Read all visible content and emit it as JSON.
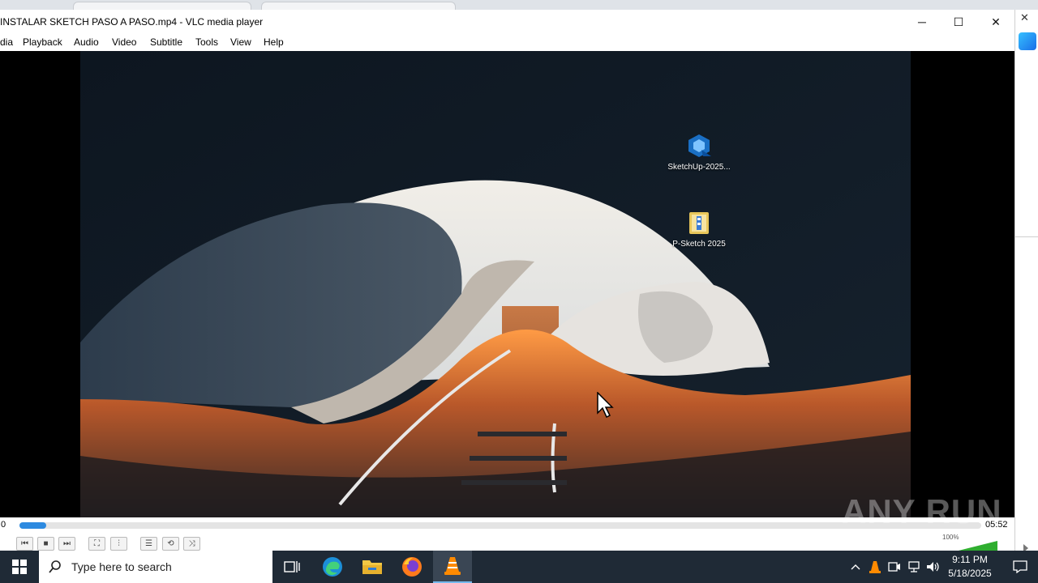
{
  "window": {
    "title": "INSTALAR SKETCH PASO A PASO.mp4 - VLC media player",
    "controls": {
      "minimize": "─",
      "maximize": "☐",
      "close": "✕"
    }
  },
  "menu": [
    "dia",
    "Playback",
    "Audio",
    "Video",
    "Subtitle",
    "Tools",
    "View",
    "Help"
  ],
  "desktop_icons": [
    {
      "label": "SketchUp-2025...",
      "icon": "sketchup-icon"
    },
    {
      "label": "P-Sketch 2025",
      "icon": "folder-archive-icon"
    }
  ],
  "playback": {
    "elapsed": "0",
    "total": "05:52",
    "progress": 0.028,
    "volume_label": "100%",
    "volume": 1.0
  },
  "controls": {
    "prev": "⏮",
    "stop": "■",
    "next": "⏭",
    "fullscreen": "⛶",
    "extended": "⫶",
    "playlist": "☰",
    "loop": "⟲",
    "shuffle": "⤨"
  },
  "watermark": "ANY RUN",
  "taskbar": {
    "search_placeholder": "Type here to search",
    "apps": [
      "task-view-icon",
      "edge-icon",
      "file-explorer-icon",
      "firefox-icon",
      "vlc-icon"
    ],
    "time": "9:11 PM",
    "date": "5/18/2025"
  },
  "colors": {
    "accent": "#2d8ae0",
    "taskbar": "#1f2a36"
  }
}
